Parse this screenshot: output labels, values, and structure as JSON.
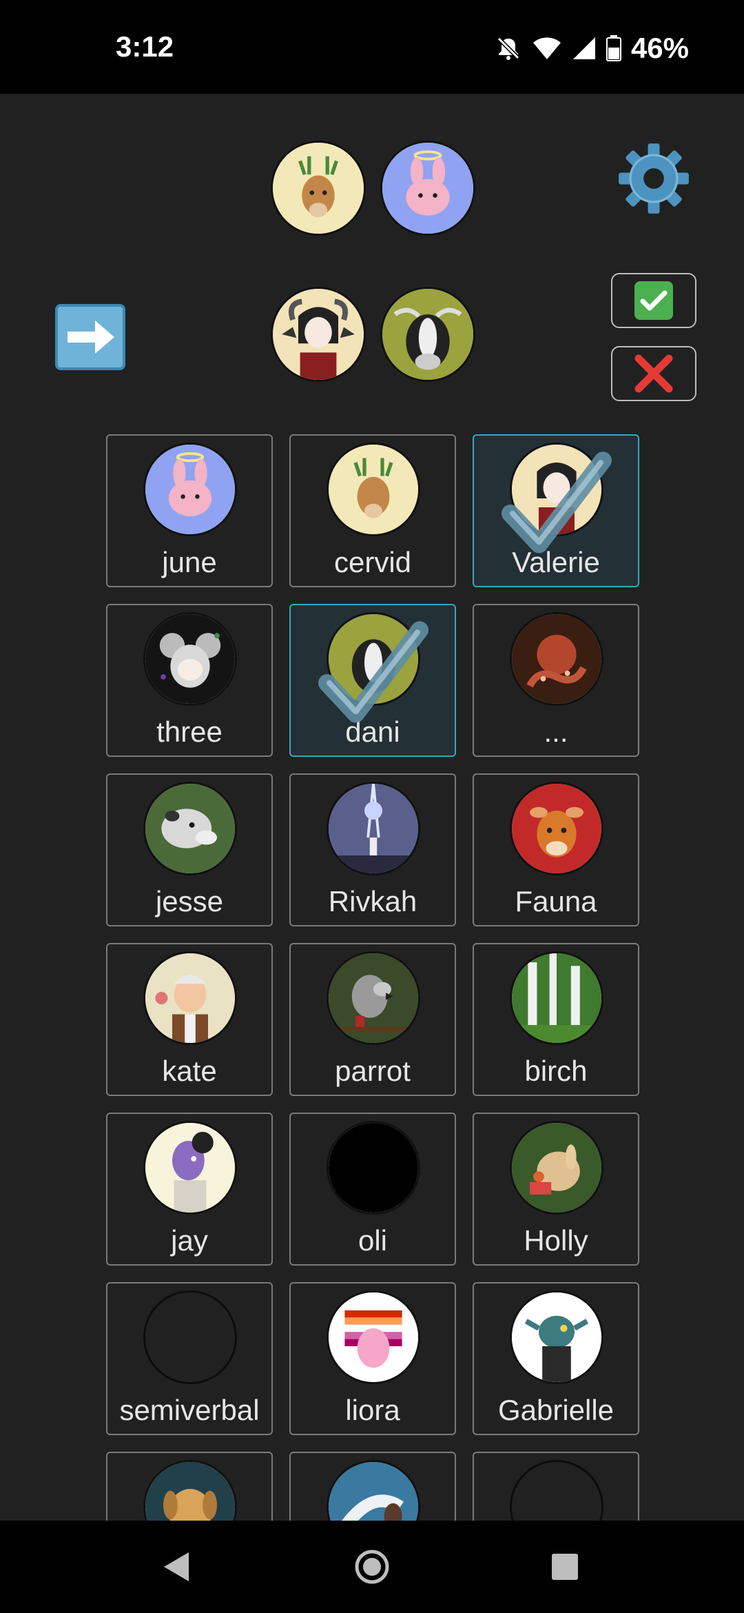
{
  "status": {
    "time": "3:12",
    "battery": "46%"
  },
  "top_icons": {
    "gear": "gear-icon",
    "arrow": "right-arrow-icon",
    "confirm": "check-mark-icon",
    "cancel": "cross-mark-icon"
  },
  "users": [
    {
      "name": "june",
      "selected": false,
      "art": "bunny-halo"
    },
    {
      "name": "cervid",
      "selected": false,
      "art": "deer"
    },
    {
      "name": "Valerie",
      "selected": true,
      "art": "horned-girl"
    },
    {
      "name": "three",
      "selected": false,
      "art": "mouse-girl"
    },
    {
      "name": "dani",
      "selected": true,
      "art": "cow"
    },
    {
      "name": "...",
      "selected": false,
      "art": "octopus"
    },
    {
      "name": "jesse",
      "selected": false,
      "art": "opossum"
    },
    {
      "name": "Rivkah",
      "selected": false,
      "art": "sky-figure"
    },
    {
      "name": "Fauna",
      "selected": false,
      "art": "fawn"
    },
    {
      "name": "kate",
      "selected": false,
      "art": "old-man"
    },
    {
      "name": "parrot",
      "selected": false,
      "art": "parrot"
    },
    {
      "name": "birch",
      "selected": false,
      "art": "birch-trees"
    },
    {
      "name": "jay",
      "selected": false,
      "art": "purple-character"
    },
    {
      "name": "oli",
      "selected": false,
      "art": "black"
    },
    {
      "name": "Holly",
      "selected": false,
      "art": "rabbit"
    },
    {
      "name": "semiverbal",
      "selected": false,
      "art": "empty"
    },
    {
      "name": "liora",
      "selected": false,
      "art": "pink-creature"
    },
    {
      "name": "Gabrielle",
      "selected": false,
      "art": "teal-creature"
    },
    {
      "name": "",
      "selected": false,
      "art": "dog"
    },
    {
      "name": "",
      "selected": false,
      "art": "dragon"
    },
    {
      "name": "",
      "selected": false,
      "art": "empty"
    }
  ]
}
